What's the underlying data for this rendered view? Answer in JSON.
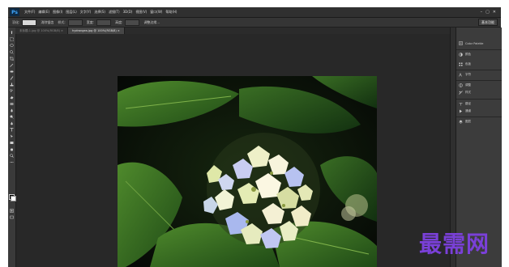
{
  "app": {
    "logo": "Ps",
    "menus": [
      "文件(F)",
      "编辑(E)",
      "图像(I)",
      "图层(L)",
      "文字(Y)",
      "选择(S)",
      "滤镜(T)",
      "3D(D)",
      "视图(V)",
      "窗口(W)",
      "帮助(H)"
    ],
    "window_controls": [
      "–",
      "▢",
      "✕"
    ]
  },
  "options_bar": {
    "feather_label": "羽化:",
    "feather_value": "0 像素",
    "antialias_label": "消除锯齿",
    "style_label": "样式:",
    "style_value": "正常",
    "width_label": "宽度:",
    "height_label": "高度:",
    "refine_edge_label": "调整边缘...",
    "workspace": "基本功能"
  },
  "tabs": [
    {
      "label": "未标题-1.jpg @ 100%(RGB/8) ×",
      "active": false
    },
    {
      "label": "hydrangea.jpg @ 100%(RGB/8) ×",
      "active": true
    }
  ],
  "right_panel": {
    "items": [
      {
        "icon": "history-icon",
        "label": "Color Palette"
      },
      {
        "icon": "color-icon",
        "label": "颜色"
      },
      {
        "icon": "swatches-icon",
        "label": "色板"
      },
      {
        "icon": "character-icon",
        "label": "字符"
      },
      {
        "icon": "adjustments-icon",
        "label": "调整"
      },
      {
        "icon": "styles-icon",
        "label": "样式"
      },
      {
        "icon": "paths-icon",
        "label": "路径"
      },
      {
        "icon": "channels-icon",
        "label": "通道"
      },
      {
        "icon": "layers-icon",
        "label": "图层"
      }
    ]
  },
  "watermark": "最需网",
  "colors": {
    "app_bg": "#282828",
    "panel_bg": "#3c3c3c",
    "accent": "#7a40d8"
  }
}
